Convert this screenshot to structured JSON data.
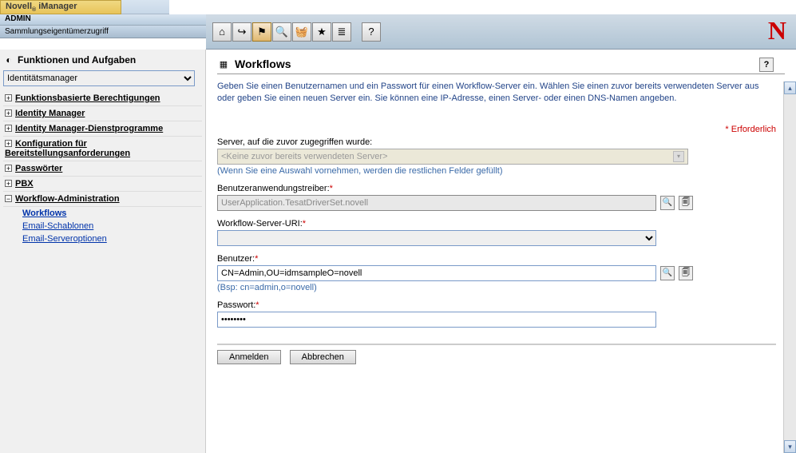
{
  "brand": {
    "name": "Novell",
    "product": "iManager",
    "reg": "®"
  },
  "header": {
    "admin": "ADMIN",
    "scope": "Sammlungseigentümerzugriff"
  },
  "toolbar": {
    "items": [
      {
        "name": "home-icon",
        "glyph": "⌂"
      },
      {
        "name": "exit-icon",
        "glyph": "↪"
      },
      {
        "name": "flag-icon",
        "glyph": "⚑",
        "active": true
      },
      {
        "name": "search-icon",
        "glyph": "🔍"
      },
      {
        "name": "basket-icon",
        "glyph": "🧺"
      },
      {
        "name": "star-icon",
        "glyph": "★"
      },
      {
        "name": "list-icon",
        "glyph": "≣"
      },
      {
        "name": "help-icon",
        "glyph": "?"
      }
    ]
  },
  "sidebar": {
    "title": "Funktionen und Aufgaben",
    "role_selected": "Identitätsmanager",
    "items": [
      {
        "label": "Funktionsbasierte Berechtigungen",
        "expanded": false
      },
      {
        "label": "Identity Manager",
        "expanded": false
      },
      {
        "label": "Identity Manager-Dienstprogramme",
        "expanded": false
      },
      {
        "label": "Konfiguration für Bereitstellungsanforderungen",
        "expanded": false
      },
      {
        "label": "Passwörter",
        "expanded": false
      },
      {
        "label": "PBX",
        "expanded": false
      },
      {
        "label": "Workflow-Administration",
        "expanded": true,
        "children": [
          {
            "label": "Workflows",
            "bold": true
          },
          {
            "label": "Email-Schablonen",
            "bold": false
          },
          {
            "label": "Email-Serveroptionen",
            "bold": false
          }
        ]
      }
    ]
  },
  "content": {
    "title": "Workflows",
    "help_glyph": "?",
    "intro": "Geben Sie einen Benutzernamen und ein Passwort für einen Workflow-Server ein. Wählen Sie einen zuvor bereits verwendeten Server aus oder geben Sie einen neuen Server ein. Sie können eine IP-Adresse, einen Server- oder einen DNS-Namen angeben.",
    "required_note": "* Erforderlich",
    "fields": {
      "prev_server": {
        "label": "Server, auf die zuvor zugegriffen wurde:",
        "placeholder": "<Keine zuvor bereits verwendeten Server>",
        "hint": "(Wenn Sie eine Auswahl vornehmen, werden die restlichen Felder gefüllt)"
      },
      "driver": {
        "label": "Benutzeranwendungstreiber:",
        "value": "UserApplication.TesatDriverSet.novell"
      },
      "uri": {
        "label": "Workflow-Server-URI:",
        "value": ""
      },
      "user": {
        "label": "Benutzer:",
        "value": "CN=Admin,OU=idmsampleO=novell",
        "hint": "(Bsp: cn=admin,o=novell)"
      },
      "password": {
        "label": "Passwort:",
        "value": "••••••••"
      }
    },
    "buttons": {
      "submit": "Anmelden",
      "cancel": "Abbrechen"
    }
  }
}
